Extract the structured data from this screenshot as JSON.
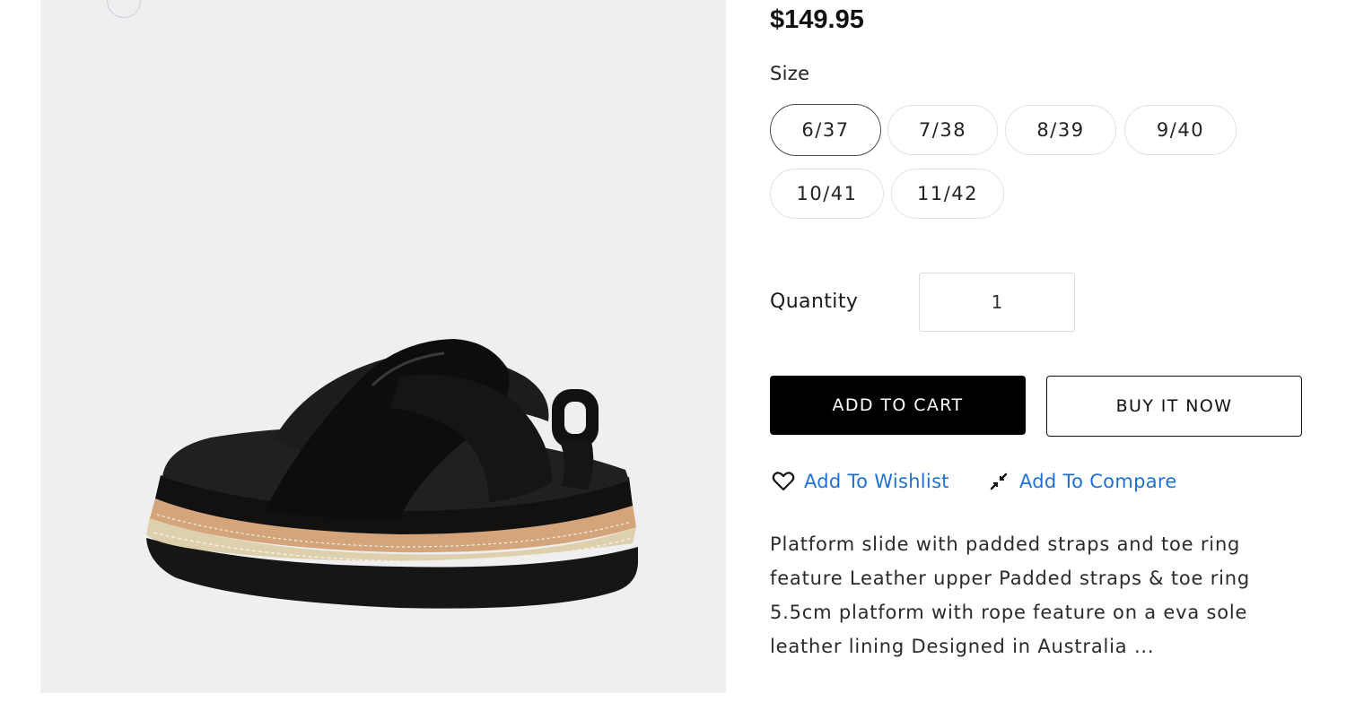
{
  "product": {
    "price": "$149.95",
    "size_label": "Size",
    "sizes": [
      {
        "label": "6/37",
        "selected": true
      },
      {
        "label": "7/38",
        "selected": false
      },
      {
        "label": "8/39",
        "selected": false
      },
      {
        "label": "9/40",
        "selected": false
      },
      {
        "label": "10/41",
        "selected": false
      },
      {
        "label": "11/42",
        "selected": false
      }
    ],
    "quantity_label": "Quantity",
    "quantity_value": "1",
    "add_to_cart": "ADD TO CART",
    "buy_it_now": "BUY IT NOW",
    "wishlist_label": "Add To Wishlist",
    "compare_label": "Add To Compare",
    "description": "Platform slide with padded straps and toe ring feature Leather upper  Padded straps & toe ring 5.5cm platform with rope feature on a eva sole leather lining Designed in Australia ..."
  },
  "colors": {
    "accent_link": "#1f70d4",
    "cart_button_bg": "#000000",
    "gallery_bg": "#efeff1"
  },
  "icons": {
    "wishlist": "heart-icon",
    "compare": "compare-arrows-icon"
  }
}
